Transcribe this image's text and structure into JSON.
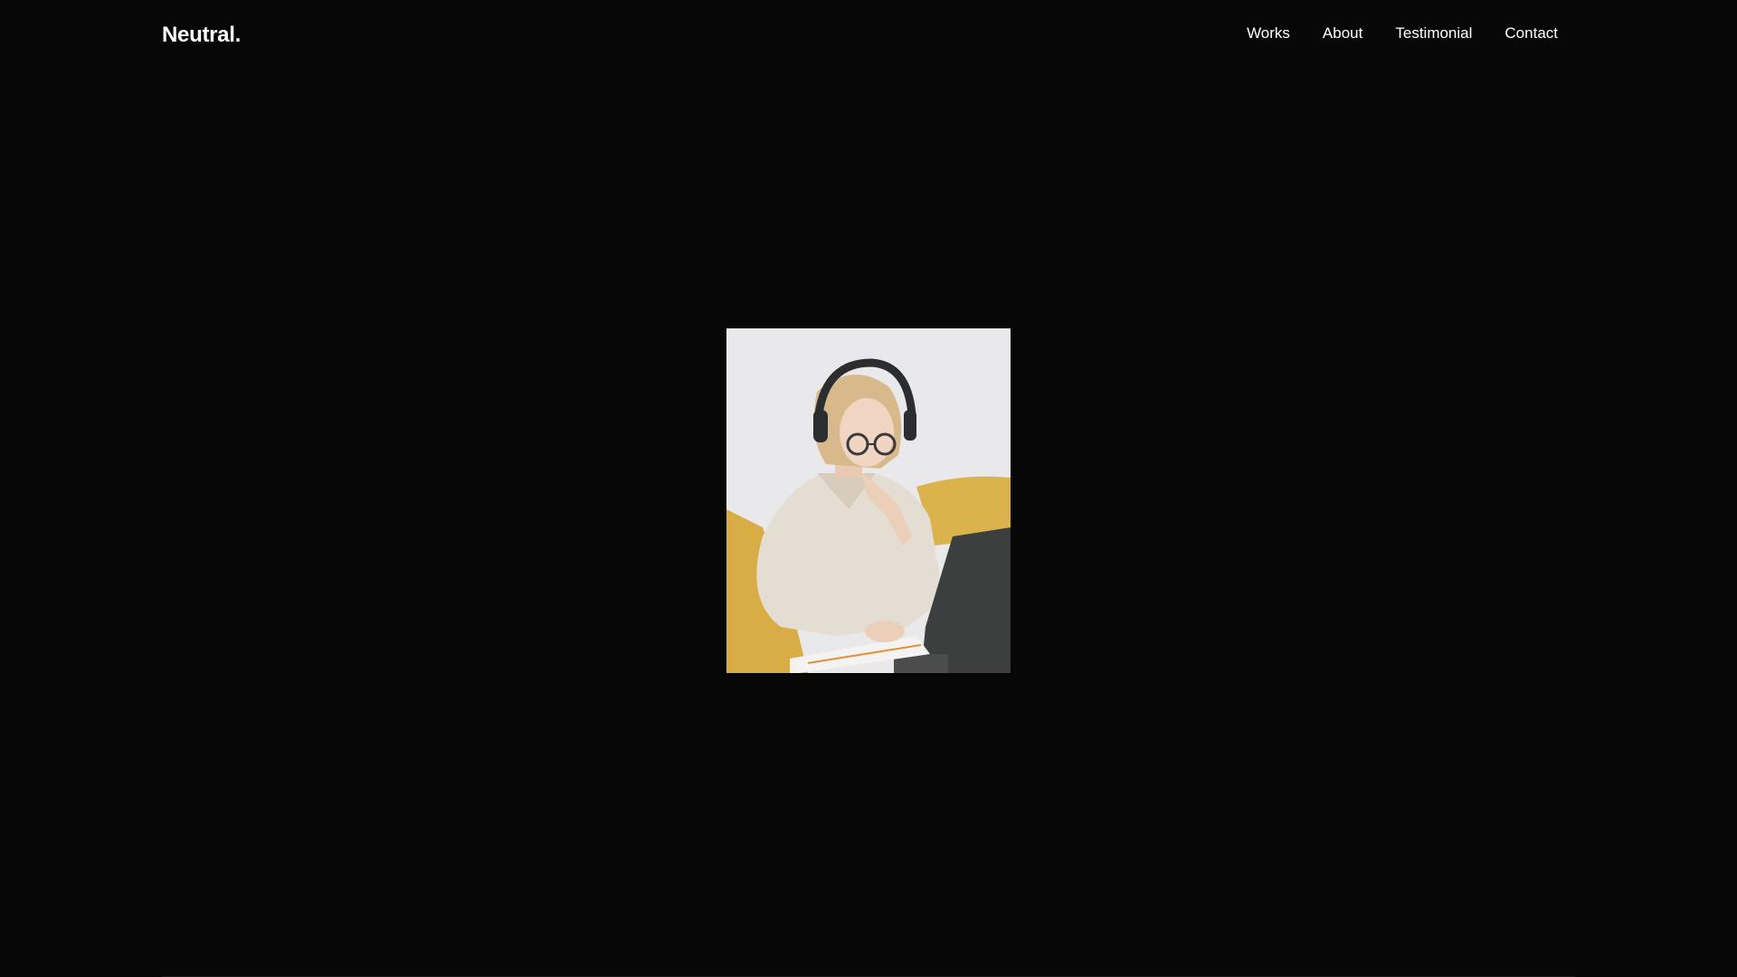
{
  "header": {
    "logo": "Neutral.",
    "nav": [
      {
        "label": "Works"
      },
      {
        "label": "About"
      },
      {
        "label": "Testimonial"
      },
      {
        "label": "Contact"
      }
    ]
  },
  "hero": {
    "photo_subject": "woman-with-headphones-working-on-laptop"
  },
  "colors": {
    "background": "#070707",
    "text": "#ffffff",
    "sofa": "#d9b24a",
    "sweater": "#e7e1d6",
    "laptop": "#3c3f3d"
  }
}
